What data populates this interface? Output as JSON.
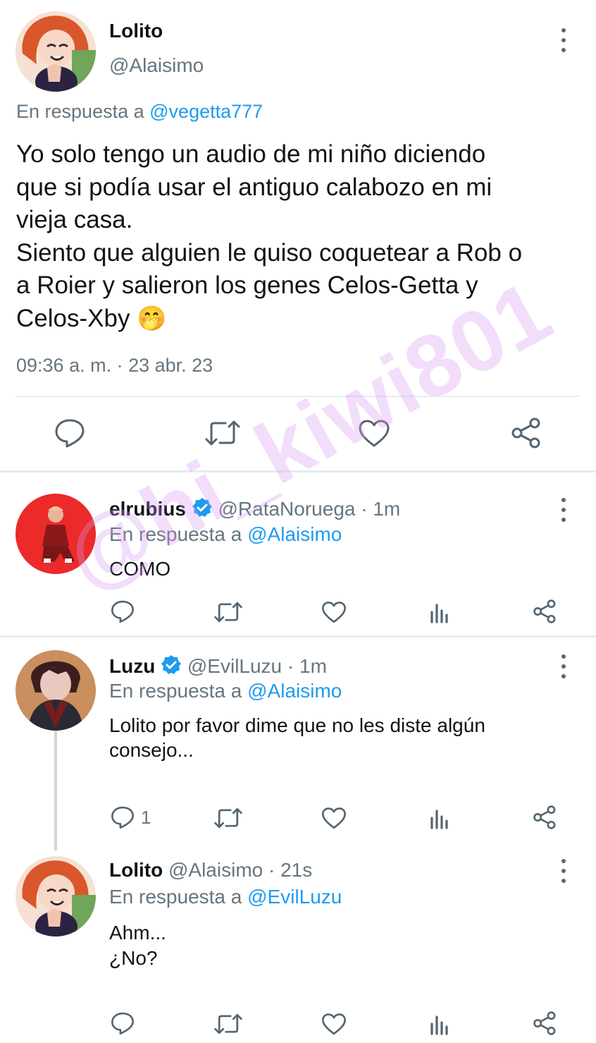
{
  "main_tweet": {
    "display_name": "Lolito",
    "handle": "@Alaisimo",
    "reply_prefix": "En respuesta a",
    "reply_to": "@vegetta777",
    "text_lines": [
      "Yo solo tengo un audio de mi niño diciendo",
      "que si podía usar el antiguo calabozo en mi",
      "vieja casa.",
      "Siento que alguien le quiso coquetear a Rob o",
      "a Roier y salieron los genes Celos-Getta y",
      "Celos-Xby"
    ],
    "emoji": "🤭",
    "timestamp": "09:36 a. m. · 23 abr. 23"
  },
  "replies": [
    {
      "display_name": "elrubius",
      "handle": "@RataNoruega",
      "time": "· 1m",
      "reply_prefix": "En respuesta a",
      "reply_to": "@Alaisimo",
      "text": "COMO",
      "verified": true
    },
    {
      "display_name": "Luzu",
      "handle": "@EvilLuzu",
      "time": "· 1m",
      "reply_prefix": "En respuesta a",
      "reply_to": "@Alaisimo",
      "text_lines": [
        "Lolito por favor dime que no les diste algún",
        "consejo..."
      ],
      "reply_count": "1",
      "verified": true
    },
    {
      "display_name": "Lolito",
      "handle": "@Alaisimo",
      "time": "· 21s",
      "reply_prefix": "En respuesta a",
      "reply_to": "@EvilLuzu",
      "text_lines": [
        "Ahm...",
        "¿No?"
      ],
      "verified": false
    }
  ],
  "watermark": "@hi_kiwi801",
  "colors": {
    "link": "#1d9bf0",
    "muted": "#66757f",
    "verified": "#1d9bf0"
  },
  "icons": [
    "reply-icon",
    "retweet-icon",
    "like-icon",
    "share-icon",
    "analytics-icon",
    "more-icon",
    "verified-badge-icon"
  ]
}
